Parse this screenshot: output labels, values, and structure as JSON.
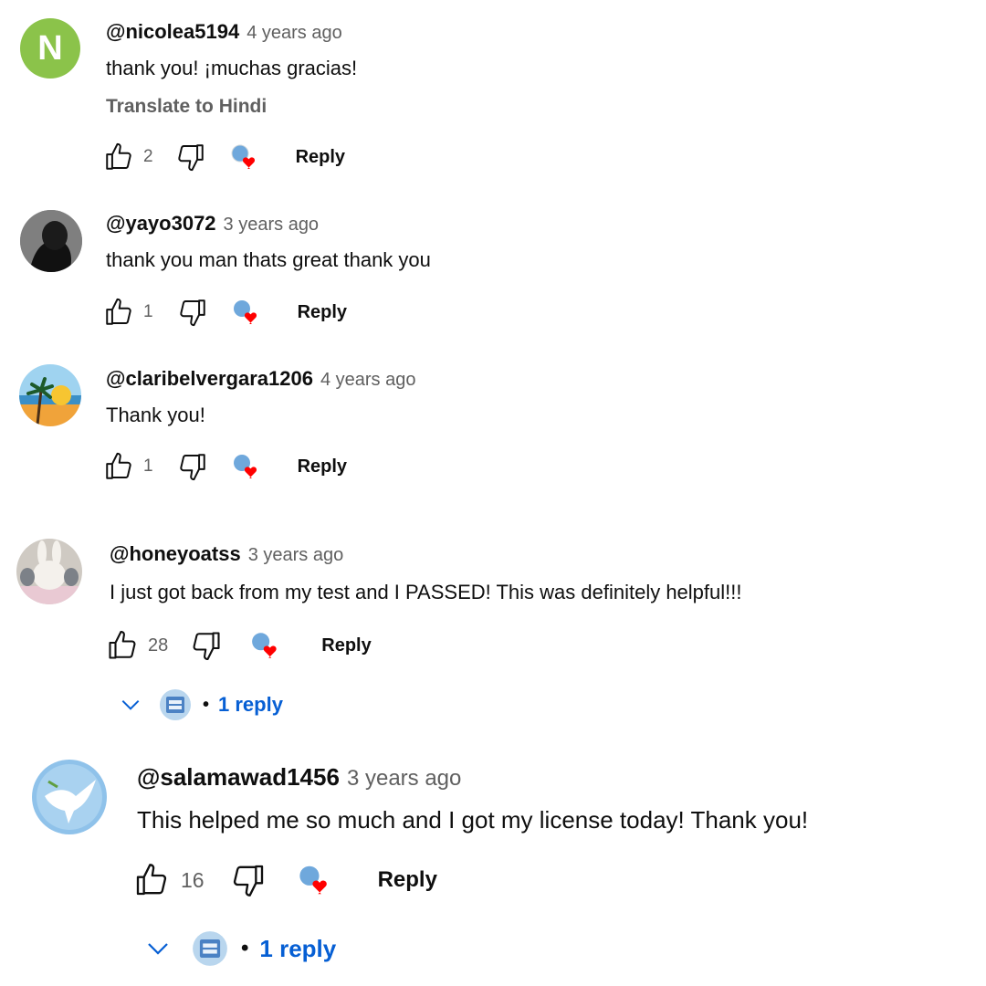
{
  "comments": [
    {
      "handle": "@nicolea5194",
      "time": "4 years ago",
      "text": "thank you! ¡muchas gracias!",
      "translate": "Translate to Hindi",
      "avatar_letter": "N",
      "avatar_color": "#8bc34a",
      "likes": "2",
      "reply_label": "Reply"
    },
    {
      "handle": "@yayo3072",
      "time": "3 years ago",
      "text": "thank you man thats great thank you",
      "likes": "1",
      "reply_label": "Reply"
    },
    {
      "handle": "@claribelvergara1206",
      "time": "4 years ago",
      "text": "Thank you!",
      "likes": "1",
      "reply_label": "Reply"
    },
    {
      "handle": "@honeyoatss",
      "time": "3 years ago",
      "text": "I just got back from my test and I PASSED! This was definitely helpful!!!",
      "likes": "28",
      "reply_label": "Reply",
      "replies_label": "1 reply"
    },
    {
      "handle": "@salamawad1456",
      "time": "3 years ago",
      "text": "This helped me so much and I got my license today! Thank you!",
      "likes": "16",
      "reply_label": "Reply",
      "replies_label": "1 reply"
    }
  ],
  "colors": {
    "link_blue": "#065fd4",
    "heart_red": "#ff0000",
    "secondary_text": "#606060"
  },
  "icons": [
    "thumbs-up-icon",
    "thumbs-down-icon",
    "creator-heart-icon",
    "chevron-down-icon"
  ]
}
